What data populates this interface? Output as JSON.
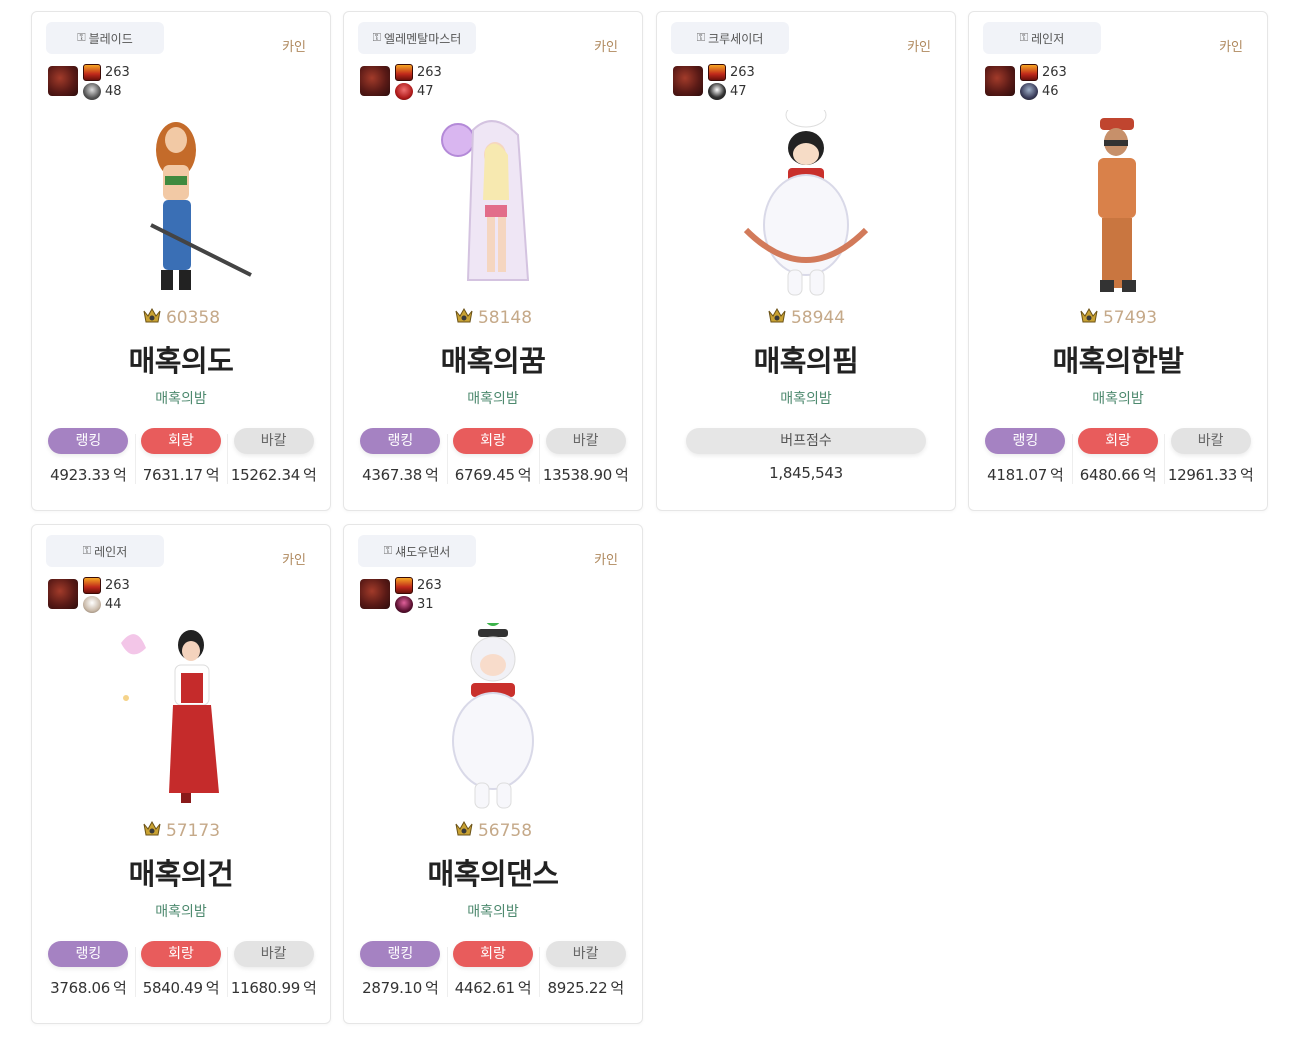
{
  "labels": {
    "ranking": "랭킹",
    "heal": "회랑",
    "bakal": "바칼",
    "buff_score": "버프점수",
    "unit": "억"
  },
  "cards": [
    {
      "job": "블레이드",
      "server": "카인",
      "emblem_top": "263",
      "emblem_bottom": "48",
      "fame": "60358",
      "name": "매혹의도",
      "guild": "매혹의밤",
      "type": "dealer",
      "ranking": "4923.33",
      "heal": "7631.17",
      "bakal": "15262.34"
    },
    {
      "job": "엘레멘탈마스터",
      "server": "카인",
      "emblem_top": "263",
      "emblem_bottom": "47",
      "fame": "58148",
      "name": "매혹의꿈",
      "guild": "매혹의밤",
      "type": "dealer",
      "ranking": "4367.38",
      "heal": "6769.45",
      "bakal": "13538.90"
    },
    {
      "job": "크루세이더",
      "server": "카인",
      "emblem_top": "263",
      "emblem_bottom": "47",
      "fame": "58944",
      "name": "매혹의핌",
      "guild": "매혹의밤",
      "type": "buffer",
      "buff_score": "1,845,543"
    },
    {
      "job": "레인저",
      "server": "카인",
      "emblem_top": "263",
      "emblem_bottom": "46",
      "fame": "57493",
      "name": "매혹의한발",
      "guild": "매혹의밤",
      "type": "dealer",
      "ranking": "4181.07",
      "heal": "6480.66",
      "bakal": "12961.33"
    },
    {
      "job": "레인저",
      "server": "카인",
      "emblem_top": "263",
      "emblem_bottom": "44",
      "fame": "57173",
      "name": "매혹의건",
      "guild": "매혹의밤",
      "type": "dealer",
      "ranking": "3768.06",
      "heal": "5840.49",
      "bakal": "11680.99"
    },
    {
      "job": "섀도우댄서",
      "server": "카인",
      "emblem_top": "263",
      "emblem_bottom": "31",
      "fame": "56758",
      "name": "매혹의댄스",
      "guild": "매혹의밤",
      "type": "dealer",
      "ranking": "2879.10",
      "heal": "4462.61",
      "bakal": "8925.22"
    }
  ],
  "colors": {
    "ranking_pill": "#a582c2",
    "heal_pill": "#e85c5c",
    "bakal_pill": "#e3e3e3",
    "fame_text": "#c5a989",
    "guild_text": "#4e8a6f",
    "server_text": "#b08a5f"
  },
  "icons": {
    "job": "job-badge-icon",
    "fame": "fame-crest-icon",
    "emblem_main": "main-emblem-icon",
    "emblem_top": "red-emblem-icon",
    "emblem_bottom": "creature-emblem-icon"
  }
}
